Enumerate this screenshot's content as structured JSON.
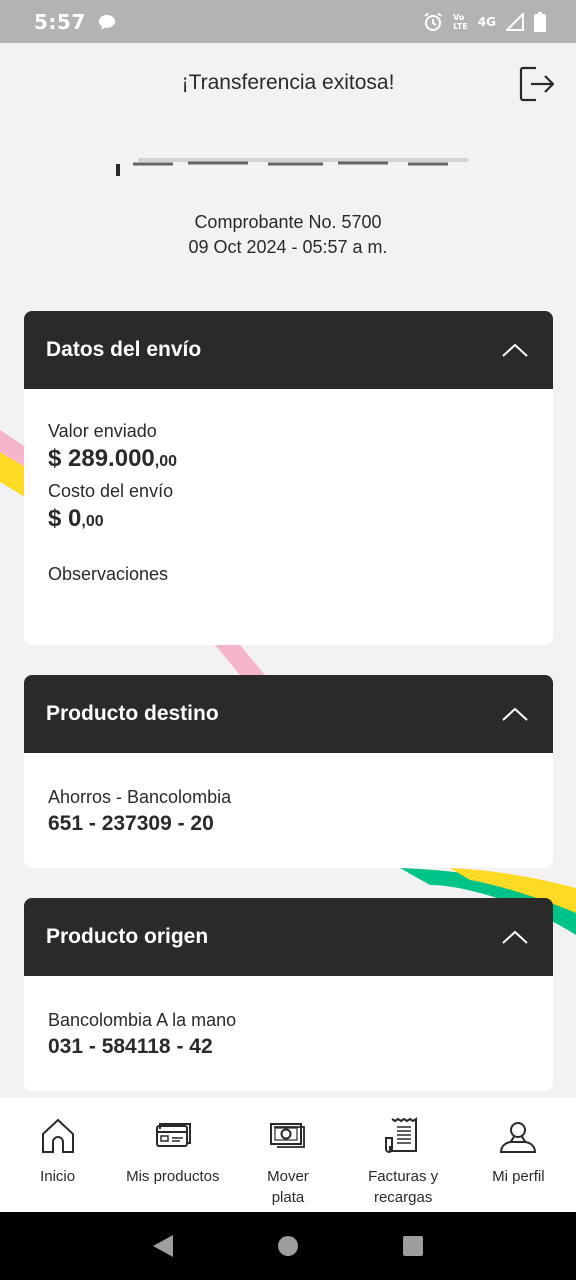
{
  "status_bar": {
    "time": "5:57",
    "network": "4G",
    "volte_top": "Vo",
    "volte_bottom": "LTE"
  },
  "header": {
    "title": "¡Transferencia exitosa!"
  },
  "receipt": {
    "number": "Comprobante No. 5700",
    "datetime": "09 Oct 2024 - 05:57 a m."
  },
  "shipment": {
    "title": "Datos del envío",
    "value_label": "Valor enviado",
    "value_int": "$ 289.000",
    "value_cents": ",00",
    "cost_label": "Costo del envío",
    "cost_int": "$ 0",
    "cost_cents": ",00",
    "notes_label": "Observaciones"
  },
  "destination": {
    "title": "Producto destino",
    "type": "Ahorros - Bancolombia",
    "account": "651 - 237309 - 20"
  },
  "origin": {
    "title": "Producto origen",
    "type": "Bancolombia A la mano",
    "account": "031 - 584118 - 42"
  },
  "nav": [
    {
      "label": "Inicio",
      "icon": "home-icon"
    },
    {
      "label": "Mis productos",
      "icon": "cards-icon"
    },
    {
      "label": "Mover plata",
      "icon": "money-icon"
    },
    {
      "label": "Facturas y recargas",
      "icon": "receipt-icon"
    },
    {
      "label": "Mi perfil",
      "icon": "user-icon"
    }
  ],
  "colors": {
    "dark": "#2c2a29",
    "background": "#f2f2f4",
    "yellow": "#fdda24",
    "pink": "#f5b6cd",
    "green": "#00c389"
  }
}
